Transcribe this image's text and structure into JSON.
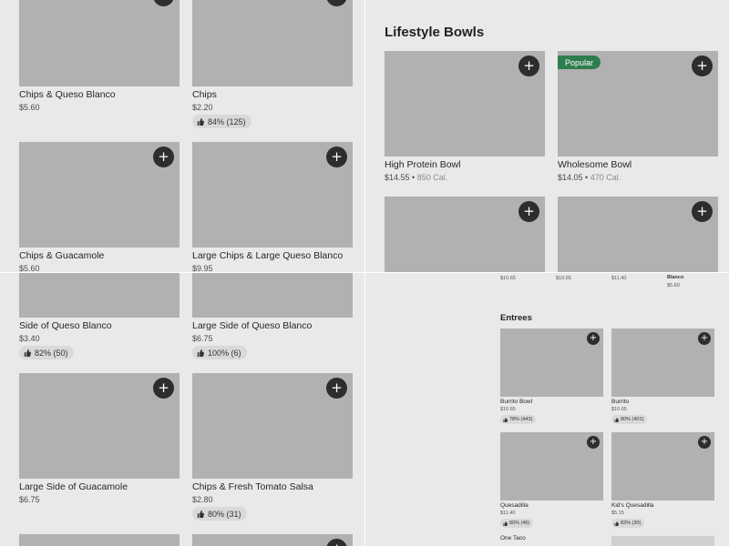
{
  "top_left": {
    "items": [
      {
        "name": "Chips & Queso Blanco",
        "price": "$5.60"
      },
      {
        "name": "Chips",
        "price": "$2.20",
        "rating": "84% (125)"
      },
      {
        "name": "Chips & Guacamole",
        "price": "$5.60"
      },
      {
        "name": "Large Chips & Large Queso Blanco",
        "price": "$9.95"
      }
    ]
  },
  "top_right": {
    "section_title": "Lifestyle Bowls",
    "popular_badge": "Popular",
    "items": [
      {
        "name": "High Protein Bowl",
        "price": "$14.55",
        "calories": "850 Cal."
      },
      {
        "name": "Wholesome Bowl",
        "price": "$14.05",
        "calories": "470 Cal."
      }
    ]
  },
  "bottom_left": {
    "items": [
      {
        "name": "Side of Queso Blanco",
        "price": "$3.40",
        "rating": "82% (50)"
      },
      {
        "name": "Large Side of Queso Blanco",
        "price": "$6.75",
        "rating": "100% (6)"
      },
      {
        "name": "Large Side of Guacamole",
        "price": "$6.75"
      },
      {
        "name": "Chips & Fresh Tomato Salsa",
        "price": "$2.80",
        "rating": "80% (31)"
      }
    ]
  },
  "bottom_right": {
    "top_prices": [
      "$10.65",
      "$10.65",
      "$11.40"
    ],
    "top_last_name": "Blanco",
    "top_last_price": "$5.60",
    "section_title": "Entrees",
    "items": [
      {
        "name": "Burrito Bowl",
        "price": "$10.65",
        "rating": "78% (443)"
      },
      {
        "name": "Burrito",
        "price": "$10.65",
        "rating": "80% (401)"
      },
      {
        "name": "Quesadilla",
        "price": "$11.40",
        "rating": "80% (46)"
      },
      {
        "name": "Kid's Quesadilla",
        "price": "$5.15",
        "rating": "83% (30)"
      },
      {
        "name": "One Taco"
      }
    ]
  },
  "icons": {
    "add": "plus-icon",
    "thumb": "thumbs-up-icon"
  },
  "colors": {
    "background": "#e9e9e9",
    "placeholder": "#b1b1b1",
    "add_button": "#2d2d2d",
    "popular_badge": "#2e7d4f",
    "rating_pill": "#d9d9d9"
  }
}
